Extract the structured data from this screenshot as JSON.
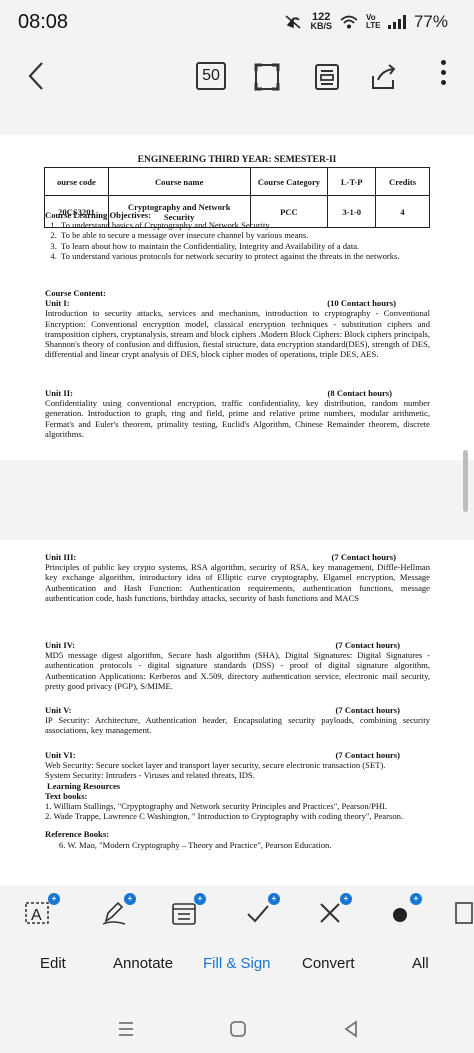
{
  "status_bar": {
    "time": "08:08",
    "speed_value": "122",
    "speed_unit": "KB/S",
    "network": "Vo LTE",
    "battery": "77%"
  },
  "toolbar": {
    "page_count": "50",
    "icons": [
      "back-arrow-icon",
      "fullscreen-icon",
      "reading-mode-icon",
      "share-icon",
      "more-vert-icon"
    ]
  },
  "document": {
    "title": "ENGINEERING THIRD YEAR: SEMESTER-II",
    "table": {
      "headers": [
        "ourse code",
        "Course name",
        "Course Category",
        "L-T-P",
        "Credits"
      ],
      "row": [
        "20CS3201",
        "Cryptography and Network Security",
        "PCC",
        "3-1-0",
        "4"
      ]
    },
    "objectives_heading": "Course Learning Objectives:",
    "objectives": [
      "To understand basics of Cryptography and Network Security.",
      "To be able to secure a message over insecure channel by various means.",
      "To learn about how to maintain the Confidentiality, Integrity and Availability of a data.",
      "To understand various protocols for network security to protect against the threats in the networks."
    ],
    "content_heading": "Course Content:",
    "units": [
      {
        "title": "Unit I:",
        "hours": "(10 Contact hours)",
        "text": "Introduction to security attacks, services and mechanism, introduction to cryptography - Conventional Encryption: Conventional encryption model, classical encryption techniques - substitution ciphers and transposition ciphers, cryptanalysis, stream and block ciphers .Modern Block Ciphers: Block ciphers principals, Shannon's theory of confusion and diffusion, fiestal structure, data encryption standard(DES), strength of DES, differential and linear crypt analysis of DES, block cipher modes of operations, triple DES, AES."
      },
      {
        "title": "Unit II:",
        "hours": "(8 Contact hours)",
        "text": "Confidentiality using conventional encryption, traffic confidentiality, key distribution, random number generation. Introduction to graph, ring and field, prime and relative prime numbers, modular arithmetic, Fermat's and Euler's theorem, primality testing, Euclid's Algorithm, Chinese Remainder theorem, discrete algorithms."
      },
      {
        "title": "Unit III:",
        "hours": "(7 Contact hours)",
        "text": "Principles of public key crypto systems, RSA algorithm, security of RSA, key management, Diffle-Hellman key exchange algorithm, introductory idea of Elliptic curve cryptography, Elgamel encryption, Message Authentication and Hash Function: Authentication requirements, authentication functions, message authentication code, hash functions, birthday attacks, security of hash functions and MACS"
      },
      {
        "title": "Unit IV:",
        "hours": "(7 Contact hours)",
        "text": "MD5 message digest algorithm, Secure hash algorithm (SHA), Digital Signatures: Digital Signatures - authentication protocols - digital signature standards (DSS) - proof of digital signature algorithm, Authentication Applications: Kerberos and X.509, directory authentication service, electronic mail security, pretty good privacy (PGP), S/MIME."
      },
      {
        "title": "Unit V:",
        "hours": "(7 Contact hours)",
        "text": "IP Security: Architecture, Authentication header, Encapsulating security payloads, combining security associations, key management."
      },
      {
        "title": "Unit VI:",
        "hours": "(7 Contact hours)",
        "text1": "Web Security: Secure socket layer and transport layer security, secure electronic transaction (SET).",
        "text2": "System Security: Intruders - Viruses and related threats, IDS."
      }
    ],
    "resources_heading": "Learning Resources",
    "textbooks_heading": "Text books:",
    "textbooks": [
      "1. William Stallings, \"Crpyptography and Network security Principles and Practices\", Pearson/PHI.",
      "2. Wade Trappe, Lawrence C Washington, \" Introduction to Cryptography with coding theory\", Pearson."
    ],
    "references_heading": "Reference Books:",
    "references": [
      "6.   W. Mao, \"Modern Cryptography – Theory and Practice\", Pearson Education."
    ]
  },
  "actions": {
    "labels": [
      "Edit",
      "Annotate",
      "Fill & Sign",
      "Convert",
      "All"
    ],
    "accent": "#1976d2"
  }
}
